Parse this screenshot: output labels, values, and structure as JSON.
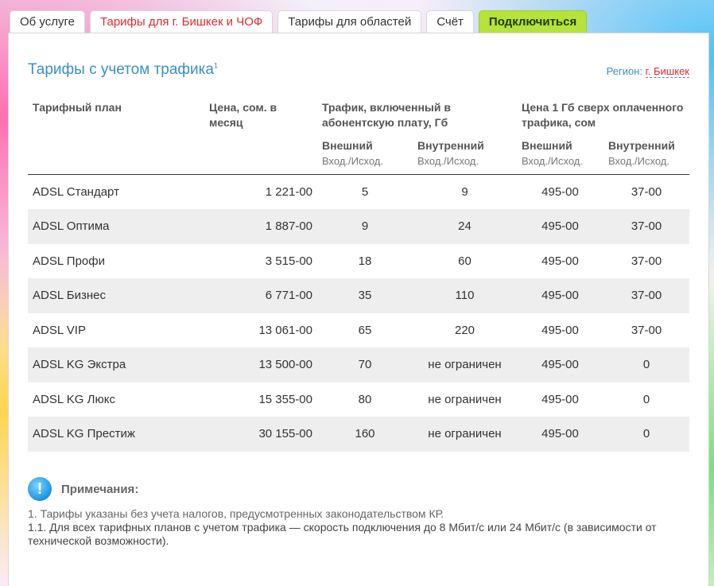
{
  "tabs": [
    {
      "label": "Об услуге"
    },
    {
      "label": "Тарифы для г. Бишкек и ЧОФ"
    },
    {
      "label": "Тарифы для областей"
    },
    {
      "label": "Счёт"
    },
    {
      "label": "Подключиться"
    }
  ],
  "section": {
    "title": "Тарифы с учетом трафика",
    "title_sup": "1",
    "region_label": "Регион:",
    "region_value": "г. Бишкек"
  },
  "table": {
    "headers": {
      "plan": "Тарифный план",
      "price": "Цена, сом. в месяц",
      "traffic": "Трафик, включенный в абонентскую плату, Гб",
      "extra": "Цена 1 Гб сверх оплаченного трафика, сом",
      "external": "Внешний",
      "internal": "Внутренний",
      "direction": "Вход./Исход."
    },
    "rows": [
      [
        "ADSL Стандарт",
        "1 221-00",
        "5",
        "9",
        "495-00",
        "37-00"
      ],
      [
        "ADSL Оптима",
        "1 887-00",
        "9",
        "24",
        "495-00",
        "37-00"
      ],
      [
        "ADSL Профи",
        "3 515-00",
        "18",
        "60",
        "495-00",
        "37-00"
      ],
      [
        "ADSL Бизнес",
        "6 771-00",
        "35",
        "110",
        "495-00",
        "37-00"
      ],
      [
        "ADSL VIP",
        "13 061-00",
        "65",
        "220",
        "495-00",
        "37-00"
      ],
      [
        "ADSL KG Экстра",
        "13 500-00",
        "70",
        "не ограничен",
        "495-00",
        "0"
      ],
      [
        "ADSL KG Люкс",
        "15 355-00",
        "80",
        "не ограничен",
        "495-00",
        "0"
      ],
      [
        "ADSL KG Престиж",
        "30 155-00",
        "160",
        "не ограничен",
        "495-00",
        "0"
      ]
    ]
  },
  "notes": {
    "title": "Примечания:",
    "icon": "info-icon",
    "items": [
      "1. Тарифы указаны без учета налогов, предусмотренных законодательством КР.",
      "1.1. Для всех тарифных планов с учетом трафика — скорость подключения до 8 Мбит/с или 24 Мбит/с (в зависимости от технической возможности)."
    ]
  },
  "colors": {
    "accent": "#3a8fc7",
    "active_tab": "#e4282f",
    "connect": "#b6e23a"
  }
}
